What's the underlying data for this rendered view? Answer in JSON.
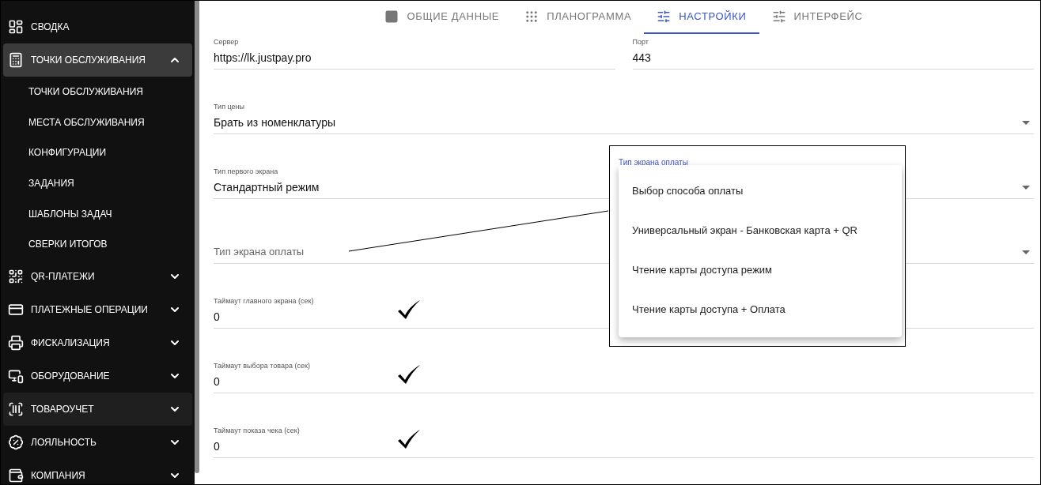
{
  "sidebar": {
    "items": [
      {
        "label": "СВОДКА",
        "kind": "link",
        "highlighted": false
      },
      {
        "label": "ТОЧКИ ОБСЛУЖИВАНИЯ",
        "kind": "group",
        "expanded": true,
        "highlighted": true,
        "children": [
          {
            "label": "ТОЧКИ ОБСЛУЖИВАНИЯ"
          },
          {
            "label": "МЕСТА ОБСЛУЖИВАНИЯ"
          },
          {
            "label": "КОНФИГУРАЦИИ"
          },
          {
            "label": "ЗАДАНИЯ"
          },
          {
            "label": "ШАБЛОНЫ ЗАДАЧ"
          },
          {
            "label": "СВЕРКИ ИТОГОВ"
          }
        ]
      },
      {
        "label": "QR-ПЛАТЕЖИ",
        "kind": "group",
        "expanded": false,
        "highlighted": false
      },
      {
        "label": "ПЛАТЕЖНЫЕ ОПЕРАЦИИ",
        "kind": "group",
        "expanded": false,
        "highlighted": false
      },
      {
        "label": "ФИСКАЛИЗАЦИЯ",
        "kind": "group",
        "expanded": false,
        "highlighted": false
      },
      {
        "label": "ОБОРУДОВАНИЕ",
        "kind": "group",
        "expanded": false,
        "highlighted": false
      },
      {
        "label": "ТОВАРОУЧЕТ",
        "kind": "group",
        "expanded": false,
        "highlighted": true
      },
      {
        "label": "ЛОЯЛЬНОСТЬ",
        "kind": "group",
        "expanded": false,
        "highlighted": false
      },
      {
        "label": "КОМПАНИЯ",
        "kind": "group",
        "expanded": false,
        "highlighted": false
      }
    ]
  },
  "tabs": [
    {
      "label": "ОБЩИЕ ДАННЫЕ",
      "selected": false
    },
    {
      "label": "ПЛАНОГРАММА",
      "selected": false
    },
    {
      "label": "НАСТРОЙКИ",
      "selected": true
    },
    {
      "label": "ИНТЕРФЕЙС",
      "selected": false
    }
  ],
  "form": {
    "rows": [
      {
        "fields": [
          {
            "kind": "text",
            "label": "Сервер",
            "value": "https://lk.justpay.pro"
          },
          {
            "kind": "text",
            "label": "Порт",
            "value": "443"
          }
        ]
      },
      {
        "fields": [
          {
            "kind": "select",
            "label": "Тип цены",
            "value": "Брать из номенклатуры"
          }
        ]
      },
      {
        "fields": [
          {
            "kind": "select",
            "label": "Тип первого экрана",
            "value": "Стандартный режим"
          }
        ]
      },
      {
        "fields": [
          {
            "kind": "select",
            "placeholder": "Тип экрана оплаты"
          }
        ]
      },
      {
        "fields": [
          {
            "kind": "text",
            "label": "Таймаут главного экрана (сек)",
            "value": "0",
            "checked": true
          }
        ]
      },
      {
        "fields": [
          {
            "kind": "text",
            "label": "Таймаут выбора товара (сек)",
            "value": "0",
            "checked": true
          }
        ]
      },
      {
        "fields": [
          {
            "kind": "text",
            "label": "Таймаут показа чека (сек)",
            "value": "0",
            "checked": true
          }
        ]
      }
    ]
  },
  "callout": {
    "label": "Тип экрана оплаты",
    "options": [
      {
        "label": "Выбор способа оплаты"
      },
      {
        "label": "Универсальный экран - Банковская карта + QR"
      },
      {
        "label": "Чтение карты доступа режим"
      },
      {
        "label": "Чтение карты доступа + Оплата"
      }
    ]
  }
}
